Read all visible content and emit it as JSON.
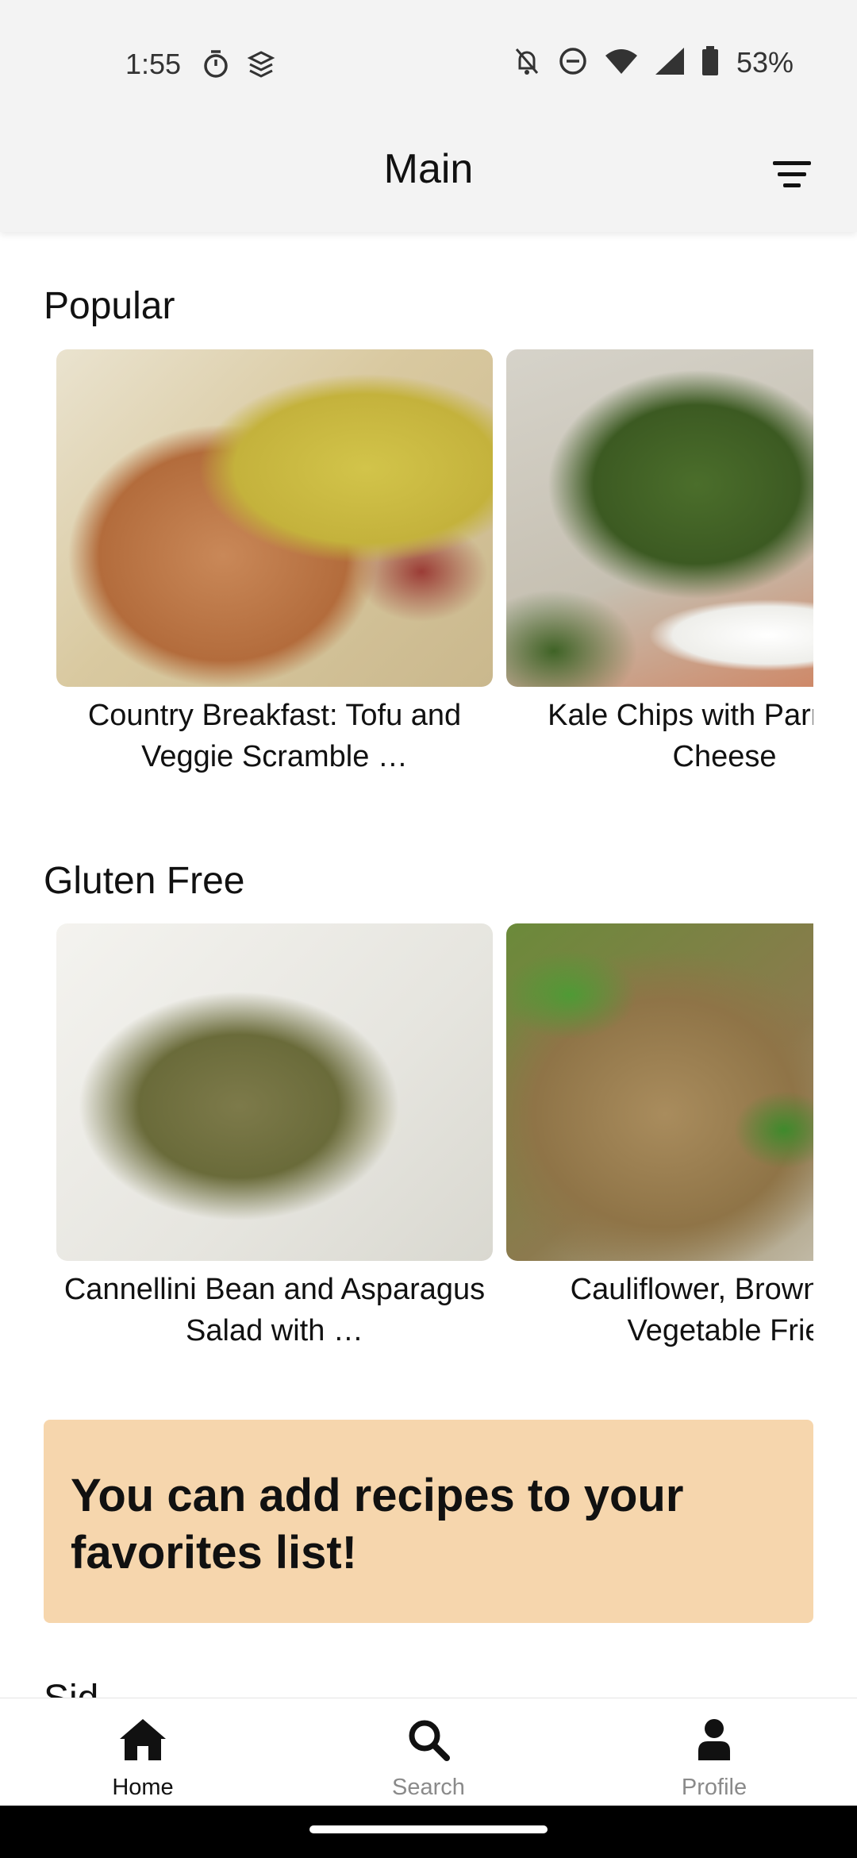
{
  "status_bar": {
    "time": "1:55",
    "battery": "53%",
    "icons": [
      "timer-icon",
      "stack-icon",
      "notifications-off-icon",
      "do-not-disturb-icon",
      "wifi-icon",
      "signal-icon",
      "battery-icon"
    ]
  },
  "toolbar": {
    "title": "Main",
    "filter_icon": "filter-icon"
  },
  "sections": [
    {
      "title": "Popular",
      "cards": [
        {
          "title": "Country Breakfast: Tofu and Veggie Scramble …"
        },
        {
          "title": "Kale Chips with Parmesan Cheese"
        }
      ]
    },
    {
      "title": "Gluten Free",
      "cards": [
        {
          "title": "Cannellini Bean and Asparagus Salad with …"
        },
        {
          "title": "Cauliflower, Brown and Vegetable Frie"
        }
      ]
    }
  ],
  "banner": {
    "text": "You can add recipes to your favorites list!",
    "background": "#f6d6ad"
  },
  "next_section_peek": "Sid",
  "bottom_nav": {
    "items": [
      {
        "label": "Home",
        "icon": "home-icon",
        "active": true
      },
      {
        "label": "Search",
        "icon": "search-icon",
        "active": false
      },
      {
        "label": "Profile",
        "icon": "profile-icon",
        "active": false
      }
    ]
  }
}
